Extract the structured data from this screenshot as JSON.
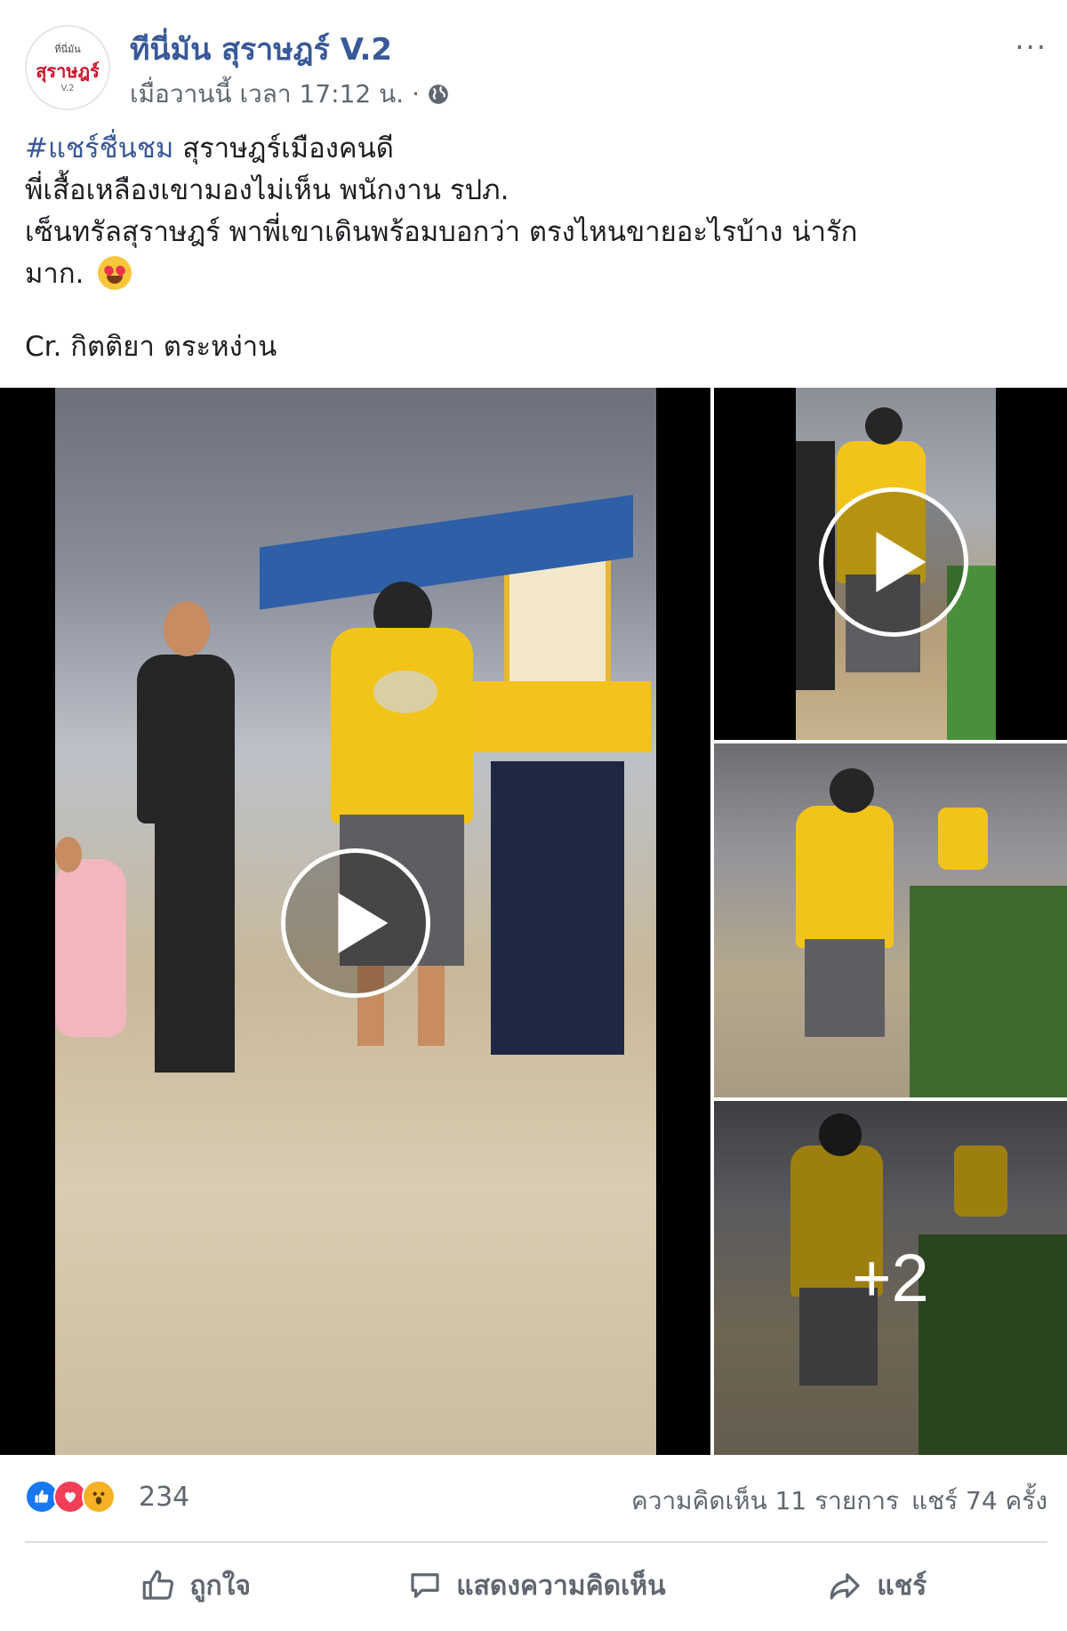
{
  "post": {
    "page_name": "ทีนี่มัน สุราษฎร์ V.2",
    "avatar": {
      "top_text": "ที่นี่มัน",
      "main_text": "สุราษฎร์",
      "sub_text": "V.2"
    },
    "timestamp": "เมื่อวานนี้ เวลา 17:12 น. ·",
    "privacy_icon": "globe-icon",
    "more_label": "···",
    "text": {
      "hashtag": "#แชร์ชื่นชม",
      "line1_rest": " สุราษฎร์เมืองคนดี",
      "line2": "พี่เสื้อเหลืองเขามองไม่เห็น พนักงาน รปภ.",
      "line3": "เซ็นทรัลสุราษฎร์ พาพี่เขาเดินพร้อมบอกว่า ตรงไหนขายอะไรบ้าง น่ารัก",
      "line4": "มาก. ",
      "emoji": "heart-eyes-emoji"
    },
    "credit": "Cr. กิตติยา ตระหง่าน"
  },
  "media": {
    "more_count": "+2"
  },
  "reactions": {
    "icons": [
      "like-icon",
      "love-icon",
      "wow-icon"
    ],
    "count": "234",
    "comments": "ความคิดเห็น 11 รายการ",
    "shares": "แชร์ 74 ครั้ง"
  },
  "actions": {
    "like": "ถูกใจ",
    "comment": "แสดงความคิดเห็น",
    "share": "แชร์"
  },
  "colors": {
    "link": "#385898",
    "muted": "#606770",
    "like_blue": "#1877f2",
    "love_red": "#f33e58",
    "wow_yellow": "#f7b125"
  }
}
